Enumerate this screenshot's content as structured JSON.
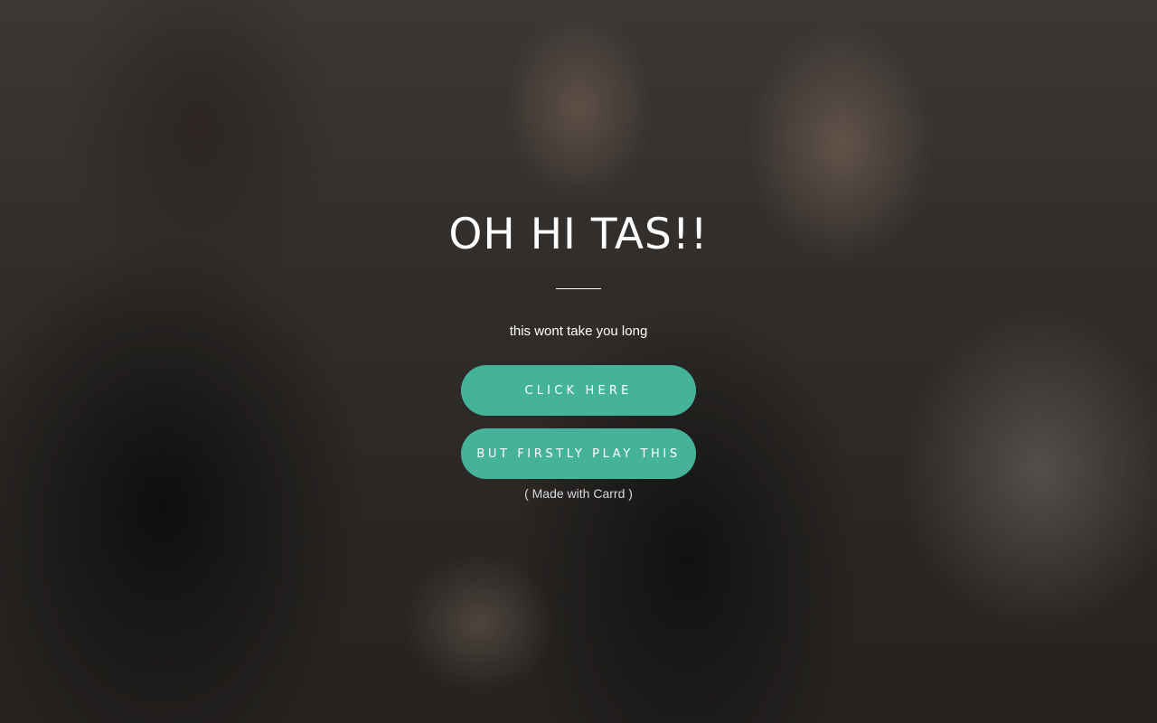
{
  "page": {
    "title": "OH HI TAS!!",
    "subtitle": "this wont take you long",
    "buttons": [
      {
        "label": "CLICK HERE"
      },
      {
        "label": "BUT FIRSTLY PLAY THIS"
      }
    ],
    "credit": "( Made with Carrd )"
  },
  "colors": {
    "button": "#44b39a",
    "text": "#ffffff"
  }
}
